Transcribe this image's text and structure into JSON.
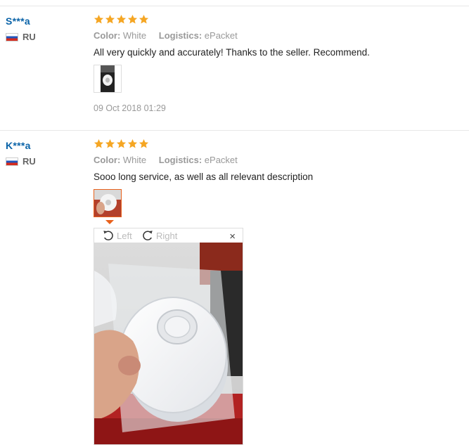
{
  "reviews": [
    {
      "user": "S***a",
      "country": "RU",
      "rating": 5,
      "color_label": "Color:",
      "color_value": "White",
      "logistics_label": "Logistics:",
      "logistics_value": "ePacket",
      "text": "All very quickly and accurately! Thanks to the seller. Recommend.",
      "date": "09 Oct 2018 01:29"
    },
    {
      "user": "K***a",
      "country": "RU",
      "rating": 5,
      "color_label": "Color:",
      "color_value": "White",
      "logistics_label": "Logistics:",
      "logistics_value": "ePacket",
      "text": "Sooo long service, as well as all relevant description"
    }
  ],
  "viewer": {
    "rotate_left": "Left",
    "rotate_right": "Right",
    "close": "×"
  },
  "colors": {
    "star": "#f5a623",
    "user": "#0a63a8",
    "accent": "#e8611c"
  }
}
